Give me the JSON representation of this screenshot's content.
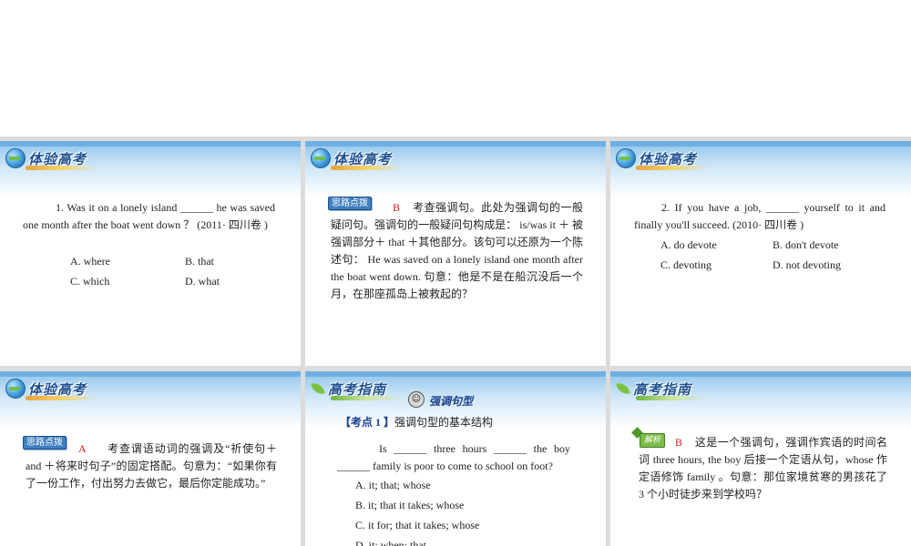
{
  "headers": {
    "exam": "体验高考",
    "guide": "高考指南"
  },
  "s1": {
    "question": "1. Was it on a lonely island ______ he was saved one month after the boat went down ？ (2011· 四川卷 )",
    "optA": "A. where",
    "optB": "B. that",
    "optC": "C. which",
    "optD": "D. what"
  },
  "s2": {
    "tag": "思路点拨",
    "answer": "B",
    "body": "考查强调句。此处为强调句的一般疑问句。强调句的一般疑问句构成是： is/was it ＋ 被强调部分＋ that ＋其他部分。该句可以还原为一个陈述句： He was saved on a lonely island one month after the boat went down. 句意：他是不是在船沉没后一个月，在那座孤岛上被救起的？"
  },
  "s3": {
    "question": "2. If you have a job, ______ yourself to it and finally you'll succeed. (2010· 四川卷 )",
    "optA": "A. do devote",
    "optB": "B. don't devote",
    "optC": "C. devoting",
    "optD": "D. not devoting"
  },
  "s4": {
    "tag": "思路点拨",
    "answer": "A",
    "body": "考查谓语动词的强调及“祈使句＋ and ＋将来时句子”的固定搭配。句意为：“如果你有了一份工作，付出努力去做它，最后你定能成功。”"
  },
  "s5": {
    "title": "强调句型",
    "point_label": "【考点 1 】",
    "point_text": "强调句型的基本结构",
    "question": "Is ______ three hours ______ the boy ______ family is poor to come to school on foot?",
    "optA": "A. it; that; whose",
    "optB": "B. it; that it takes; whose",
    "optC": "C. it for; that it takes; whose",
    "optD": "D. it; when; that"
  },
  "s6": {
    "tag": "解析",
    "answer": "B",
    "body": "这是一个强调句，强调作宾语的时间名词 three hours, the boy 后接一个定语从句，whose 作定语修饰 family 。句意：那位家境贫寒的男孩花了 3 个小时徒步来到学校吗？"
  },
  "icons": [
    "globe-icon",
    "leaf-icon",
    "smiley-icon",
    "diamond-icon"
  ]
}
